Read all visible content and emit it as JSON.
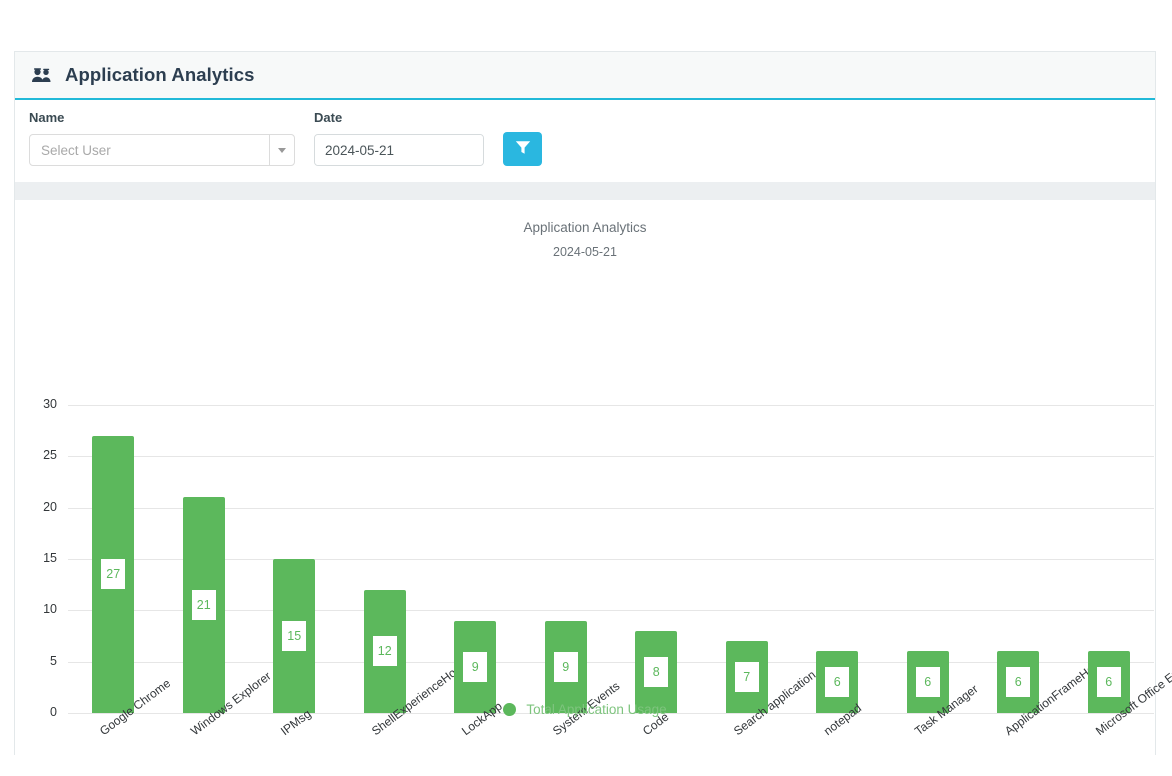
{
  "panel": {
    "title": "Application Analytics",
    "header_icon": "users-group-icon"
  },
  "filters": {
    "name_label": "Name",
    "user_select_placeholder": "Select User",
    "user_select_value": "",
    "date_label": "Date",
    "date_value": "2024-05-21",
    "calendar_icon": "calendar-icon",
    "filter_button_icon": "funnel-filter-icon",
    "filter_button_color": "#2ab7e0"
  },
  "chart_data": {
    "type": "bar",
    "title": "Application Analytics",
    "subtitle": "2024-05-21",
    "xlabel": "",
    "ylabel": "",
    "ylim": [
      0,
      30
    ],
    "yticks": [
      0,
      5,
      10,
      15,
      20,
      25,
      30
    ],
    "grid": true,
    "legend_position": "bottom",
    "series_color": "#5cb85c",
    "legend": [
      "Total Application Usage"
    ],
    "categories": [
      "Google Chrome",
      "Windows Explorer",
      "IPMsg",
      "ShellExperienceHost",
      "LockApp",
      "System Events",
      "Code",
      "Search application",
      "notepad",
      "Task Manager",
      "ApplicationFrameHost",
      "Microsoft Office Excel"
    ],
    "series": [
      {
        "name": "Total Application Usage",
        "values": [
          27,
          21,
          15,
          12,
          9,
          9,
          8,
          7,
          6,
          6,
          6,
          6
        ]
      }
    ]
  }
}
